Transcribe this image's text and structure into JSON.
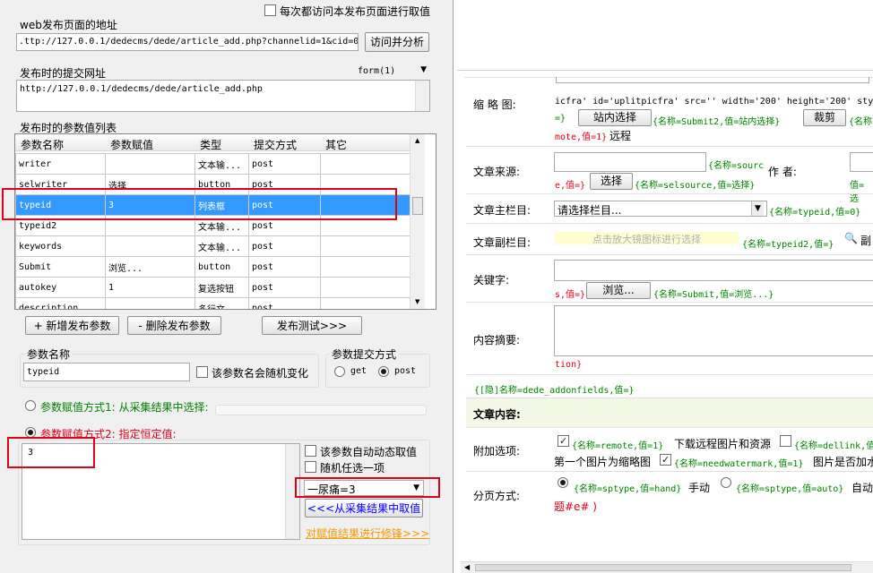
{
  "left": {
    "visit_each_time_label": "每次都访问本发布页面进行取值",
    "web_url_label": "web发布页面的地址",
    "web_url_value": ".ttp://127.0.0.1/dedecms/dede/article_add.php?channelid=1&cid=0",
    "analyze_button": "访问并分析",
    "submit_url_label": "发布时的提交网址",
    "form_select": "form(1)",
    "submit_url_value": "http://127.0.0.1/dedecms/dede/article_add.php",
    "params_list_label": "发布时的参数值列表",
    "columns": [
      "参数名称",
      "参数赋值",
      "类型",
      "提交方式",
      "其它"
    ],
    "rows": [
      {
        "name": "writer",
        "value": "",
        "type": "文本输...",
        "method": "post",
        "other": ""
      },
      {
        "name": "selwriter",
        "value": "选择",
        "type": "button",
        "method": "post",
        "other": ""
      },
      {
        "name": "typeid",
        "value": "3",
        "type": "列表框",
        "method": "post",
        "other": ""
      },
      {
        "name": "typeid2",
        "value": "",
        "type": "文本输...",
        "method": "post",
        "other": ""
      },
      {
        "name": "keywords",
        "value": "",
        "type": "文本输...",
        "method": "post",
        "other": ""
      },
      {
        "name": "Submit",
        "value": "浏览...",
        "type": "button",
        "method": "post",
        "other": ""
      },
      {
        "name": "autokey",
        "value": "1",
        "type": "复选按钮",
        "method": "post",
        "other": ""
      },
      {
        "name": "description",
        "value": "",
        "type": "多行文...",
        "method": "post",
        "other": ""
      }
    ],
    "add_param_button": "+ 新增发布参数",
    "delete_param_button": "- 删除发布参数",
    "publish_test_button": "发布测试>>>",
    "param_name_label": "参数名称",
    "param_name_value": "typeid",
    "random_name_label": "该参数名会随机变化",
    "submit_method_label": "参数提交方式",
    "get_label": "get",
    "post_label": "post",
    "mode1_label": "参数赋值方式1: 从采集结果中选择:",
    "mode2_label": "参数赋值方式2: 指定恒定值:",
    "constant_value": "3",
    "auto_dynamic_label": "该参数自动动态取值",
    "random_pick_label": "随机任选一项",
    "option_select": "一尿痛=3",
    "from_result_button": "<<<从采集结果中取值",
    "modify_link": "对赋值结果进行修锋>>>"
  },
  "right": {
    "thumb_label": "缩 略 图:",
    "thumb_code_line": "icfra' id='uplitpicfra' src='' width='200' height='200' sty",
    "thumb_code_close": "=}",
    "site_select_button": "站内选择",
    "submit2_tag": "{名称=Submit2,值=站内选择}",
    "crop_button": "裁剪",
    "crop_tag": "{名称",
    "remote_tag_tail": "mote,值=1}",
    "remote_suffix": "远程",
    "source_label": "文章来源:",
    "source_tag": "{名称=sourc",
    "source_tag2": "e,值=}",
    "source_select_button": "选择",
    "selsource_tag": "{名称=selsource,值=选择}",
    "author_label": "作 者:",
    "author_tag": "值=选",
    "main_col_label": "文章主栏目:",
    "main_col_select": "请选择栏目...",
    "typeid_tag": "{名称=typeid,值=0}",
    "sub_col_label": "文章副栏目:",
    "sub_col_hint": "点击放大镜图标进行选择",
    "typeid2_tag": "{名称=typeid2,值=}",
    "sub_col_tail": "副",
    "keywords_label": "关键字:",
    "keywords_tag": "s,值=}",
    "browse_button": "浏览...",
    "submit_tag": "{名称=Submit,值=浏览...}",
    "summary_label": "内容摘要:",
    "summary_tag": "tion}",
    "hidden_tag": "{[隐]名称=dede_addonfields,值=}",
    "content_header": "文章内容:",
    "extra_label": "附加选项:",
    "remote_tag": "{名称=remote,值=1}",
    "download_remote": "下载远程图片和资源",
    "dellink_tag": "{名称=dellink,值",
    "first_pic_text": "第一个图片为缩略图",
    "watermark_tag": "{名称=needwatermark,值=1}",
    "watermark_text": "图片是否加水",
    "paging_label": "分页方式:",
    "sptype_hand_tag": "{名称=sptype,值=hand}",
    "manual_text": "手动",
    "sptype_auto_tag": "{名称=sptype,值=auto}",
    "auto_text": "自动",
    "paging_tail": "题#e# )"
  }
}
